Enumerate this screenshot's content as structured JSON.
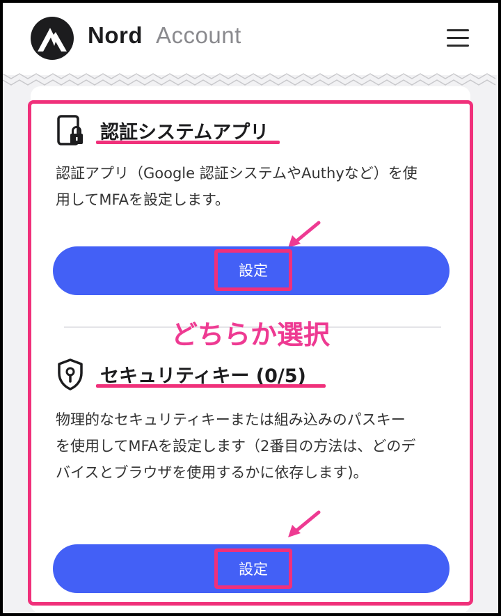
{
  "header": {
    "brand_bold": "Nord",
    "brand_light": "Account"
  },
  "sections": [
    {
      "title": "認証システムアプリ",
      "description": "認証アプリ（Google 認証システムやAuthyなど）を使用してMFAを設定します。",
      "button_label": "設定"
    },
    {
      "title": "セキュリティキー (0/5)",
      "description": "物理的なセキュリティキーまたは組み込みのパスキーを使用してMFAを設定します（2番目の方法は、どのデバイスとブラウザを使用するかに依存します)。",
      "button_label": "設定"
    }
  ],
  "annotation": "どちらか選択",
  "colors": {
    "accent_button": "#4360f6",
    "highlight": "#f0307a",
    "annotation_text": "#ee3a92"
  },
  "icons": [
    "nord-mountain-logo",
    "menu-icon",
    "phone-lock-icon",
    "shield-keyhole-icon",
    "pink-arrow-icon"
  ]
}
